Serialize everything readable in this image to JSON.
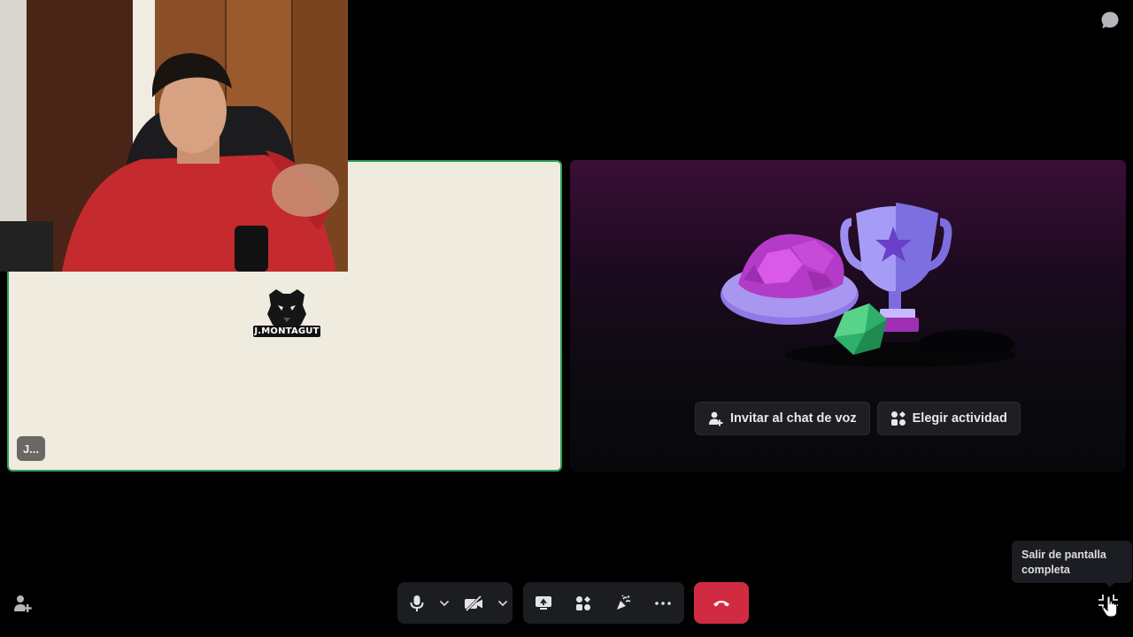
{
  "stage": {
    "left_tile": {
      "logo_text": "J.MONTAGUT",
      "name_badge": "J..."
    },
    "right_tile": {
      "invite_label": "Invitar al chat de voz",
      "activity_label": "Elegir actividad"
    }
  },
  "controls": {
    "tooltip": "Salir de pantalla completa"
  },
  "colors": {
    "speaking_border": "#2f9e5a",
    "hangup": "#d12b41",
    "control_bg": "#1c1d21"
  }
}
